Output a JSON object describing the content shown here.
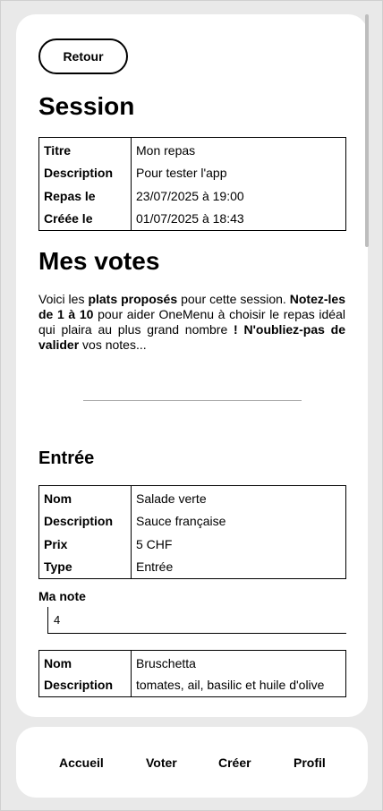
{
  "back_label": "Retour",
  "session": {
    "title": "Session",
    "rows": [
      {
        "key": "Titre",
        "value": "Mon repas"
      },
      {
        "key": "Description",
        "value": "Pour tester l'app"
      },
      {
        "key": "Repas le",
        "value": "23/07/2025 à 19:00"
      },
      {
        "key": "Créée le",
        "value": "01/07/2025 à 18:43"
      }
    ]
  },
  "votes": {
    "title": "Mes votes",
    "intro": {
      "t1": "Voici les ",
      "b1": "plats proposés",
      "t2": " pour cette session. ",
      "b2": "Notez-les de 1 à 10",
      "t3": " pour aider OneMenu à choisir le repas idéal qui plaira au plus grand nombre ",
      "b3": "! N'oubliez-pas de valider",
      "t4": " vos notes..."
    }
  },
  "sections": [
    {
      "title": "Entrée",
      "dishes": [
        {
          "rows": [
            {
              "key": "Nom",
              "value": "Salade verte"
            },
            {
              "key": "Description",
              "value": "Sauce française"
            },
            {
              "key": "Prix",
              "value": "5 CHF"
            },
            {
              "key": "Type",
              "value": "Entrée"
            }
          ],
          "note_label": "Ma note",
          "note_value": "4"
        },
        {
          "rows": [
            {
              "key": "Nom",
              "value": "Bruschetta"
            },
            {
              "key": "Description",
              "value": "tomates, ail, basilic et huile d'olive"
            }
          ]
        }
      ]
    }
  ],
  "nav": {
    "items": [
      "Accueil",
      "Voter",
      "Créer",
      "Profil"
    ]
  }
}
